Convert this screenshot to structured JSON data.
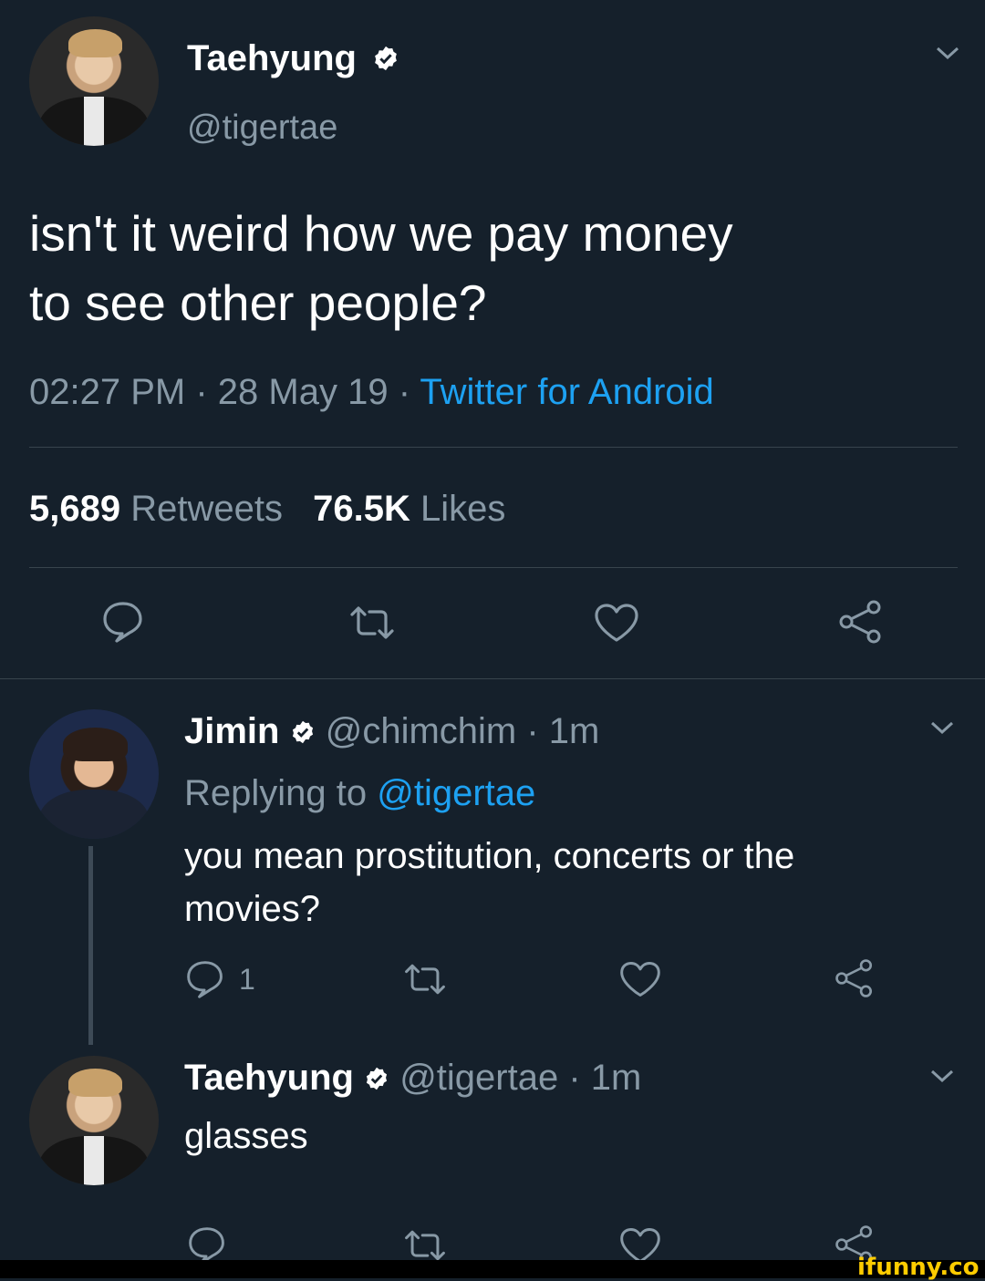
{
  "main_tweet": {
    "display_name": "Taehyung",
    "handle": "@tigertae",
    "text_line1": "isn't it weird how we pay money",
    "text_line2": "to see other people?",
    "time": "02:27 PM",
    "date": "28 May 19",
    "separator": "·",
    "source": "Twitter for Android",
    "retweets_count": "5,689",
    "retweets_label": "Retweets",
    "likes_count": "76.5K",
    "likes_label": "Likes"
  },
  "reply1": {
    "display_name": "Jimin",
    "handle": "@chimchim",
    "age": "· 1m",
    "replying_to_label": "Replying to",
    "replying_to_handle": "@tigertae",
    "text_line1": "you mean prostitution, concerts or the",
    "text_line2": "movies?",
    "reply_count": "1"
  },
  "reply2": {
    "display_name": "Taehyung",
    "handle": "@tigertae",
    "age": "· 1m",
    "text": "glasses"
  },
  "watermark": "ifunny.co",
  "colors": {
    "background": "#15202b",
    "link": "#1da1f2",
    "muted": "#8899a6",
    "divider": "#38444d"
  },
  "icons": [
    "reply-icon",
    "retweet-icon",
    "like-icon",
    "share-icon",
    "chevron-down-icon",
    "verified-badge-icon"
  ]
}
